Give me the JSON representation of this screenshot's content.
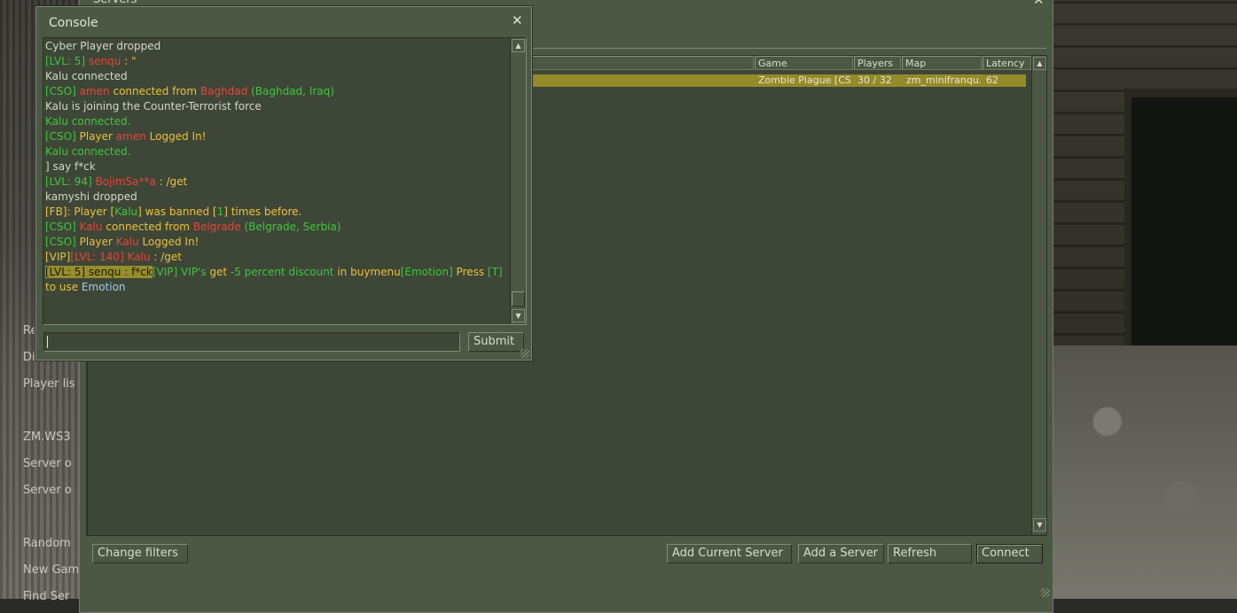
{
  "left_menu": [
    "Re",
    "Disco",
    "Player lis",
    "ZM.WS3",
    "Server o",
    "Server o",
    "Random",
    "New Gam",
    "Find Ser"
  ],
  "servers": {
    "title": "Servers",
    "close_glyph": "✕",
    "columns": [
      "Game",
      "Players",
      "Map",
      "Latency"
    ],
    "rows": [
      {
        "game": "Zombie Plague [CSO]",
        "players": "30 / 32",
        "map": "zm_minifranqu...",
        "latency": "62"
      }
    ],
    "buttons": {
      "change_filters": "Change filters",
      "add_current": "Add Current Server",
      "add_server": "Add a Server",
      "refresh": "Refresh",
      "connect": "Connect"
    }
  },
  "console": {
    "title": "Console",
    "close_glyph": "✕",
    "submit_label": "Submit",
    "input_value": "",
    "lines": [
      [
        {
          "t": "Cyber Player dropped",
          "c": "w"
        }
      ],
      [
        {
          "t": "[LVL: 5] ",
          "c": "g"
        },
        {
          "t": "senqu",
          "c": "r"
        },
        {
          "t": " : \"",
          "c": "y"
        }
      ],
      [
        {
          "t": "Kalu connected",
          "c": "w"
        }
      ],
      [
        {
          "t": "[CSO] ",
          "c": "g"
        },
        {
          "t": "amen",
          "c": "r"
        },
        {
          "t": " connected from ",
          "c": "y"
        },
        {
          "t": "Baghdad",
          "c": "r"
        },
        {
          "t": " (Baghdad, Iraq)",
          "c": "g"
        }
      ],
      [
        {
          "t": "Kalu is joining the Counter-Terrorist force",
          "c": "w"
        }
      ],
      [
        {
          "t": "Kalu connected.",
          "c": "g"
        }
      ],
      [
        {
          "t": "[CSO] ",
          "c": "g"
        },
        {
          "t": "Player ",
          "c": "y"
        },
        {
          "t": "amen",
          "c": "r"
        },
        {
          "t": " Logged In!",
          "c": "y"
        }
      ],
      [
        {
          "t": "Kalu connected.",
          "c": "g"
        }
      ],
      [
        {
          "t": "] say f*ck",
          "c": "w"
        }
      ],
      [
        {
          "t": "[LVL: 94] ",
          "c": "g"
        },
        {
          "t": "BojimSa**a",
          "c": "r"
        },
        {
          "t": " : /get",
          "c": "y"
        }
      ],
      [
        {
          "t": "kamyshi dropped",
          "c": "w"
        }
      ],
      [
        {
          "t": "[FB]: Player [",
          "c": "y"
        },
        {
          "t": "Kalu",
          "c": "g"
        },
        {
          "t": "] was banned [",
          "c": "y"
        },
        {
          "t": "1",
          "c": "g"
        },
        {
          "t": "] times before.",
          "c": "y"
        }
      ],
      [
        {
          "t": "[CSO] ",
          "c": "g"
        },
        {
          "t": "Kalu",
          "c": "r"
        },
        {
          "t": " connected from ",
          "c": "y"
        },
        {
          "t": "Belgrade",
          "c": "r"
        },
        {
          "t": " (Belgrade, Serbia)",
          "c": "g"
        }
      ],
      [
        {
          "t": "[CSO] ",
          "c": "g"
        },
        {
          "t": "Player ",
          "c": "y"
        },
        {
          "t": "Kalu",
          "c": "r"
        },
        {
          "t": " Logged In!",
          "c": "y"
        }
      ],
      [
        {
          "t": "[VIP]",
          "c": "y"
        },
        {
          "t": "[LVL: 140] ",
          "c": "r"
        },
        {
          "t": "Kalu",
          "c": "r"
        },
        {
          "t": " : /get",
          "c": "y"
        }
      ],
      [
        {
          "t": "[LVL: 5] senqu : f*ck",
          "c": "hl"
        },
        {
          "t": "[VIP] VIP's ",
          "c": "g"
        },
        {
          "t": "get ",
          "c": "y"
        },
        {
          "t": "-5 percent discount",
          "c": "g"
        },
        {
          "t": " in buymenu",
          "c": "y"
        },
        {
          "t": "[Emotion]",
          "c": "g"
        },
        {
          "t": " Press ",
          "c": "y"
        },
        {
          "t": "[T]",
          "c": "g"
        },
        {
          "t": " to use ",
          "c": "y"
        },
        {
          "t": "Emotion",
          "c": "b"
        }
      ]
    ]
  }
}
